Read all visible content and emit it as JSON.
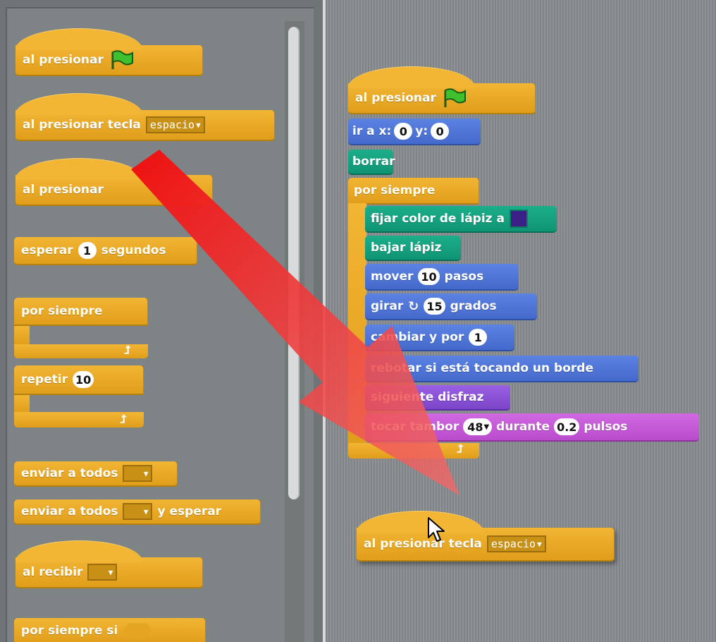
{
  "palette": {
    "blocks": {
      "when_flag": "al presionar",
      "when_key_label": "al presionar tecla",
      "when_key_value": "espacio",
      "when_clicked_partial": "al presionar",
      "wait_label": "esperar",
      "wait_value": "1",
      "wait_unit": "segundos",
      "forever": "por siempre",
      "repeat_label": "repetir",
      "repeat_value": "10",
      "broadcast": "enviar a todos",
      "broadcast_wait_label": "enviar a todos",
      "broadcast_wait_suffix": "y esperar",
      "receive": "al recibir",
      "forever_if": "por siempre si"
    }
  },
  "script": {
    "hat_label": "al presionar",
    "goto_label": "ir a x:",
    "goto_x": "0",
    "goto_y_label": "y:",
    "goto_y": "0",
    "clear": "borrar",
    "forever": "por siempre",
    "pen_color": "fijar color de lápiz a",
    "pen_down": "bajar lápiz",
    "move_label": "mover",
    "move_value": "10",
    "move_unit": "pasos",
    "turn_label": "girar",
    "turn_value": "15",
    "turn_unit": "grados",
    "change_label": "cambiar y por",
    "change_value": "1",
    "bounce": "rebotar si está tocando un borde",
    "next_costume": "siguiente disfraz",
    "drum_label": "tocar tambor",
    "drum_value": "48",
    "drum_during": "durante",
    "drum_beats": "0.2",
    "drum_unit": "pulsos"
  },
  "dragged": {
    "label": "al presionar tecla",
    "value": "espacio"
  },
  "colors": {
    "control": "#e6a822",
    "motion": "#4a6cd4",
    "pen": "#0e9a74",
    "looks": "#8a55d7",
    "sound": "#c157d4",
    "pen_swatch": "#3a1f86",
    "arrow": "#ee2020"
  }
}
